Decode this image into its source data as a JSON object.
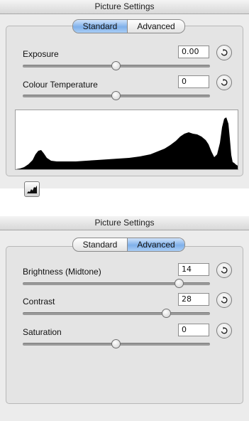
{
  "top_panel": {
    "title": "Picture Settings",
    "tabs": [
      {
        "label": "Standard",
        "active": true
      },
      {
        "label": "Advanced",
        "active": false
      }
    ],
    "controls": [
      {
        "label": "Exposure",
        "value": "0.00",
        "slider_fraction": 0.5
      },
      {
        "label": "Colour Temperature",
        "value": "0",
        "slider_fraction": 0.5
      }
    ],
    "histogram_icon": "histogram-icon"
  },
  "bottom_panel": {
    "title": "Picture Settings",
    "tabs": [
      {
        "label": "Standard",
        "active": false
      },
      {
        "label": "Advanced",
        "active": true
      }
    ],
    "controls": [
      {
        "label": "Brightness (Midtone)",
        "value": "14",
        "slider_fraction": 0.84
      },
      {
        "label": "Contrast",
        "value": "28",
        "slider_fraction": 0.77
      },
      {
        "label": "Saturation",
        "value": "0",
        "slider_fraction": 0.5
      }
    ]
  },
  "icons": {
    "reset": "reset-arrow-icon",
    "histogram": "histogram-icon"
  },
  "colors": {
    "active_tab": "#7fb0ea",
    "histogram_fill": "#000000"
  }
}
